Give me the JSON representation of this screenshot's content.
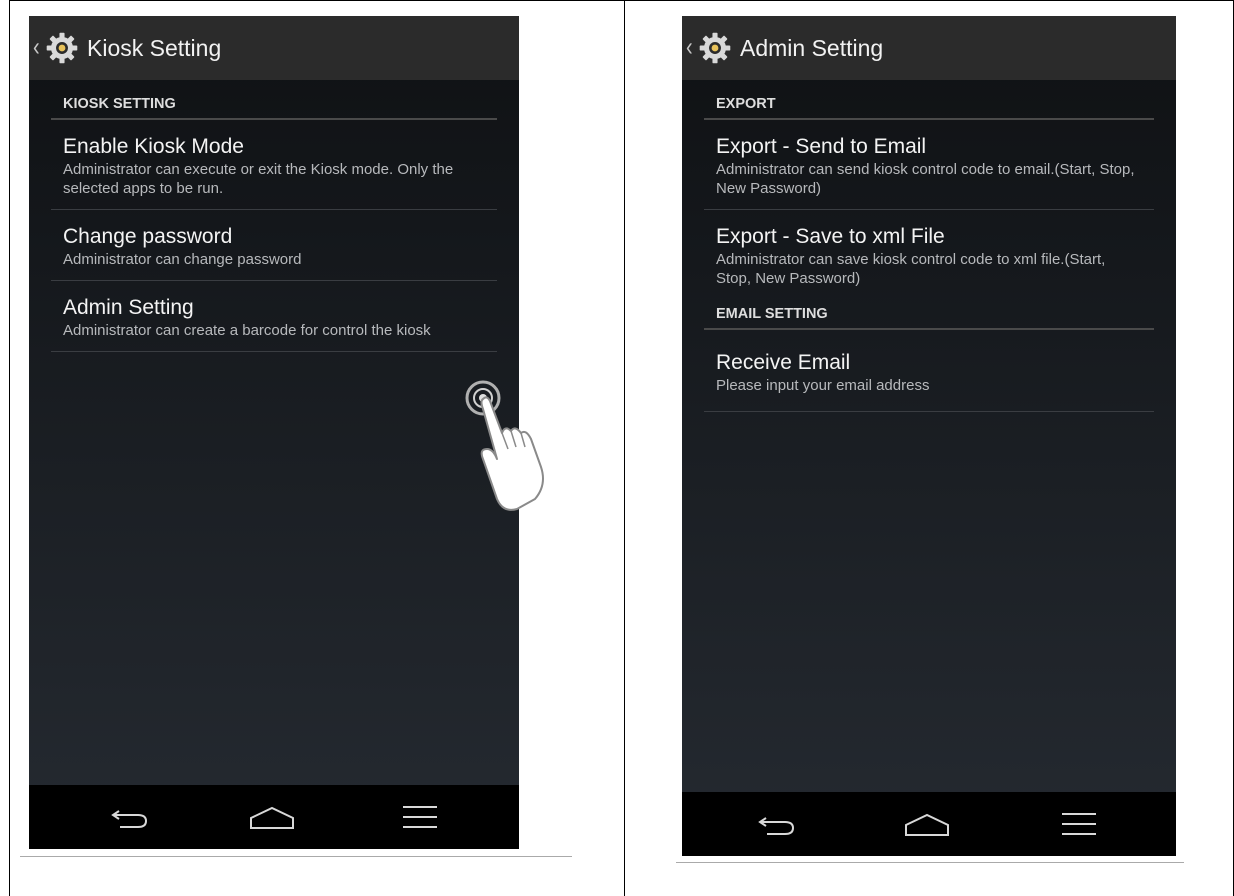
{
  "left_screen": {
    "action_bar": {
      "title": "Kiosk Setting",
      "icon": "settings-gear-icon"
    },
    "section_header": "KIOSK SETTING",
    "items": [
      {
        "title": "Enable Kiosk Mode",
        "summary": "Administrator can execute or exit the Kiosk mode. Only the selected apps to be run."
      },
      {
        "title": "Change password",
        "summary": "Administrator can change password"
      },
      {
        "title": "Admin Setting",
        "summary": "Administrator can create a barcode for control the kiosk"
      }
    ]
  },
  "right_screen": {
    "action_bar": {
      "title": "Admin Setting",
      "icon": "settings-gear-icon"
    },
    "sections": [
      {
        "header": "EXPORT",
        "items": [
          {
            "title": "Export - Send to Email",
            "summary": "Administrator can send kiosk control code to email.(Start, Stop, New Password)"
          },
          {
            "title": "Export - Save to xml File",
            "summary": "Administrator can save kiosk control code to xml file.(Start, Stop, New Password)"
          }
        ]
      },
      {
        "header": "EMAIL SETTING",
        "items": [
          {
            "title": "Receive Email",
            "summary": "Please input your email address"
          }
        ]
      }
    ]
  },
  "nav_bar": {
    "buttons": [
      "back-icon",
      "home-icon",
      "menu-icon"
    ]
  },
  "colors": {
    "action_bar": "#2b2b2b",
    "nav_bar": "#000000",
    "divider": "#4a4a4a",
    "text_primary": "#f4f4f4",
    "text_secondary": "#b7b9bc"
  }
}
